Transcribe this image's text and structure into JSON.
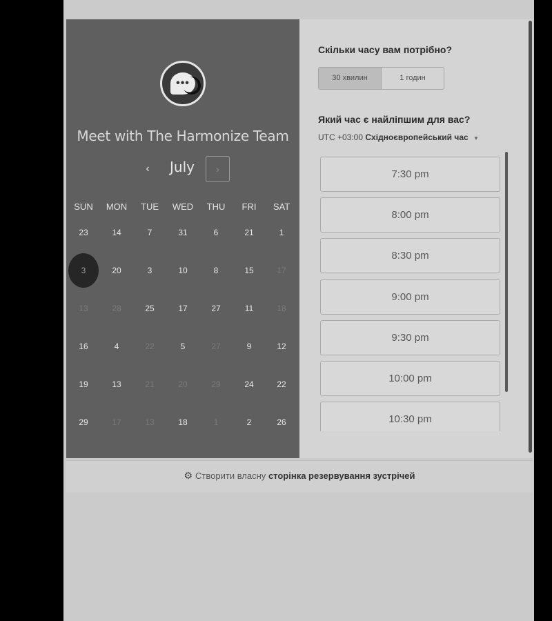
{
  "host": {
    "title": "Meet with The Harmonize Team",
    "avatar_icon": "chat-bubble-icon"
  },
  "calendar": {
    "month": "July",
    "prev_label": "‹",
    "next_label": "›",
    "weekdays": [
      "SUN",
      "MON",
      "TUE",
      "WED",
      "THU",
      "FRI",
      "SAT"
    ],
    "weeks": [
      [
        "23",
        "14",
        "7",
        "31",
        "6",
        "21",
        "1"
      ],
      [
        "3",
        "20",
        "3",
        "10",
        "8",
        "15",
        "17"
      ],
      [
        "13",
        "28",
        "25",
        "17",
        "27",
        "11",
        "18"
      ],
      [
        "16",
        "4",
        "22",
        "5",
        "27",
        "9",
        "12"
      ],
      [
        "19",
        "13",
        "21",
        "20",
        "29",
        "24",
        "22"
      ],
      [
        "29",
        "17",
        "13",
        "18",
        "1",
        "2",
        "26"
      ]
    ],
    "available": [
      [
        true,
        true,
        true,
        true,
        true,
        true,
        true
      ],
      [
        true,
        true,
        true,
        true,
        true,
        true,
        false
      ],
      [
        false,
        false,
        true,
        true,
        true,
        true,
        false
      ],
      [
        true,
        true,
        false,
        true,
        false,
        true,
        true
      ],
      [
        true,
        true,
        false,
        false,
        false,
        true,
        true
      ],
      [
        true,
        false,
        false,
        true,
        false,
        true,
        true
      ]
    ],
    "selected": [
      1,
      0
    ]
  },
  "booking": {
    "duration_question": "Скільки часу вам потрібно?",
    "durations": [
      "30 хвилин",
      "1 годин"
    ],
    "time_question": "Який час є найліпшим для вас?",
    "tz_offset": "UTC +03:00",
    "tz_name": "Східноєвропейський час",
    "slots": [
      "7:30 pm",
      "8:00 pm",
      "8:30 pm",
      "9:00 pm",
      "9:30 pm",
      "10:00 pm",
      "10:30 pm"
    ]
  },
  "footer": {
    "icon": "hubspot-sprocket-icon",
    "text": "Створити власну",
    "link": "сторінка резервування зустрічей"
  }
}
